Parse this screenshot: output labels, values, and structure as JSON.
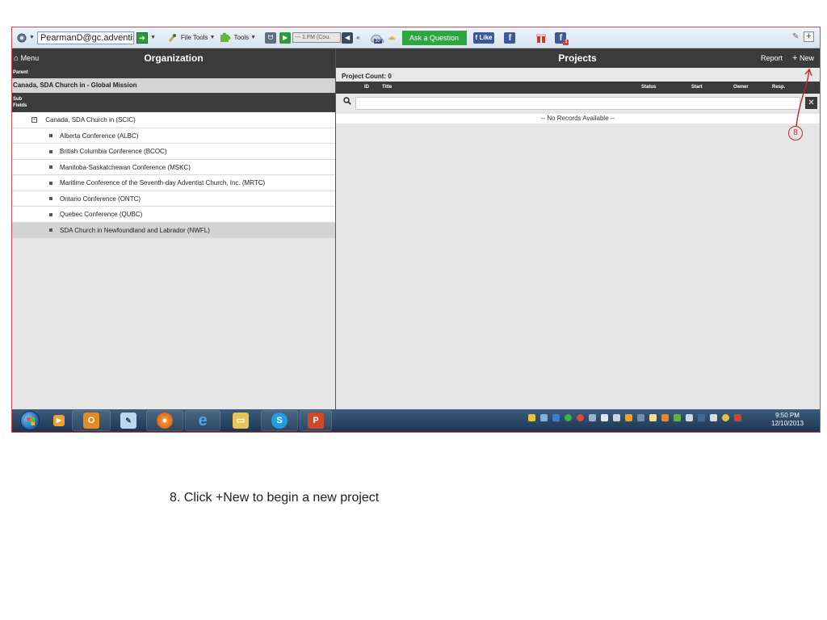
{
  "toolbar": {
    "account_email": "PearmanD@gc.adventist.",
    "file_tools_label": "File Tools",
    "tools_label": "Tools",
    "radio_station": "--- 1.FM (Cou.",
    "weather_temp": "30°",
    "ask_question_label": "Ask a Question",
    "like_label": "Like",
    "icons": [
      "gear-icon",
      "arrow-right-icon",
      "file-tools-icon",
      "puzzle-icon",
      "play-icon",
      "volume-icon",
      "weather-icon",
      "facebook-icon",
      "gift-icon",
      "facebook-notification-icon",
      "wrench-icon",
      "add-icon"
    ]
  },
  "header": {
    "menu_label": "Menu",
    "org_title": "Organization",
    "projects_title": "Projects",
    "report_label": "Report",
    "new_label": "New"
  },
  "left": {
    "parent_label": "Parent",
    "parent_value": "Canada, SDA Church in - Global Mission",
    "subfields_label_1": "Sub",
    "subfields_label_2": "Fields",
    "root": "Canada, SDA Church in (SCIC)",
    "children": [
      "Alberta Conference (ALBC)",
      "British Columbia Conference (BCOC)",
      "Manitoba-Saskatchewan Conference (MSKC)",
      "Maritime Conference of the Seventh-day Adventist Church, Inc. (MRTC)",
      "Ontario Conference (ONTC)",
      "Quebec Conference (QUBC)",
      "SDA Church in Newfoundland and Labrador (NWFL)"
    ]
  },
  "right": {
    "project_count": "Project Count: 0",
    "columns": {
      "id": "ID",
      "title": "Title",
      "status": "Status",
      "start": "Start",
      "owner": "Owner",
      "resp": "Resp."
    },
    "search_placeholder": "",
    "no_records": "-- No Records Available --"
  },
  "annotation": {
    "step_number": "8"
  },
  "taskbar": {
    "apps": [
      "media-player-icon",
      "outlook-icon",
      "notepad-icon",
      "firefox-icon",
      "internet-explorer-icon",
      "file-explorer-icon",
      "skype-icon",
      "powerpoint-icon"
    ],
    "time": "9:50 PM",
    "date": "12/10/2013"
  },
  "caption": "8.  Click +New to begin a new project"
}
